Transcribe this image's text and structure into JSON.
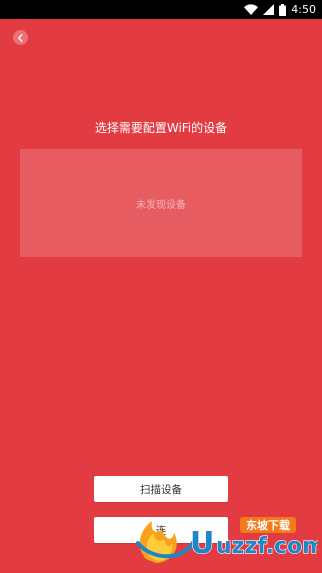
{
  "status_bar": {
    "time": "4:50",
    "icons": [
      "wifi-icon",
      "signal-icon",
      "battery-icon"
    ]
  },
  "header": {
    "back_icon": "chevron-left-icon"
  },
  "main": {
    "title": "选择需要配置WiFi的设备",
    "empty_text": "未发现设备"
  },
  "actions": {
    "scan_label": "扫描设备",
    "second_label": "连"
  },
  "watermark": {
    "brand_cn": "东坡下载",
    "brand_en": "uzzf.com"
  },
  "colors": {
    "background": "#e23b41",
    "status_bar": "#000000"
  }
}
